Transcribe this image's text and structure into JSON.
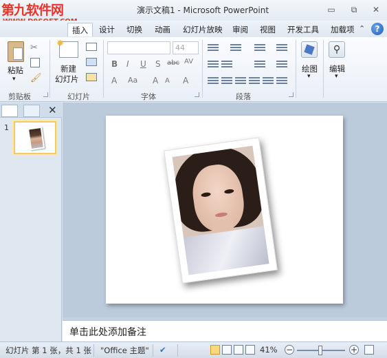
{
  "watermark": {
    "brand": "第九软件网",
    "url": "WWW.D9SOFT.COM"
  },
  "window": {
    "title": "演示文稿1 - Microsoft PowerPoint",
    "minimize": "▭",
    "restore": "⧉",
    "close": "✕"
  },
  "menu": {
    "tabs": [
      "插入",
      "设计",
      "切换",
      "动画",
      "幻灯片放映",
      "审阅",
      "视图",
      "开发工具",
      "加载项"
    ],
    "help": "?"
  },
  "ribbon": {
    "clipboard": {
      "paste": "粘贴",
      "group": "剪贴板"
    },
    "slides": {
      "new_slide_1": "新建",
      "new_slide_2": "幻灯片",
      "group": "幻灯片"
    },
    "font": {
      "size": "44",
      "group": "字体",
      "bold": "B",
      "italic": "I",
      "underline": "U",
      "strike": "abc",
      "shadow": "S",
      "case": "Aa",
      "grow": "A",
      "shrink": "A",
      "clear": "A",
      "color": "A"
    },
    "paragraph": {
      "group": "段落"
    },
    "drawing": {
      "label": "绘图"
    },
    "editing": {
      "label": "编辑"
    }
  },
  "left_pane": {
    "slide_number": "1",
    "close": "✕"
  },
  "notes": {
    "placeholder": "单击此处添加备注"
  },
  "status": {
    "slide_info": "幻灯片 第 1 张，共 1 张",
    "theme": "\"Office 主题\"",
    "zoom": "41%",
    "zoom_minus": "−",
    "zoom_plus": "+"
  },
  "colors": {
    "accent": "#f3c969",
    "watermark": "#e8342c",
    "ribbon_bg": "#e9eff7"
  }
}
